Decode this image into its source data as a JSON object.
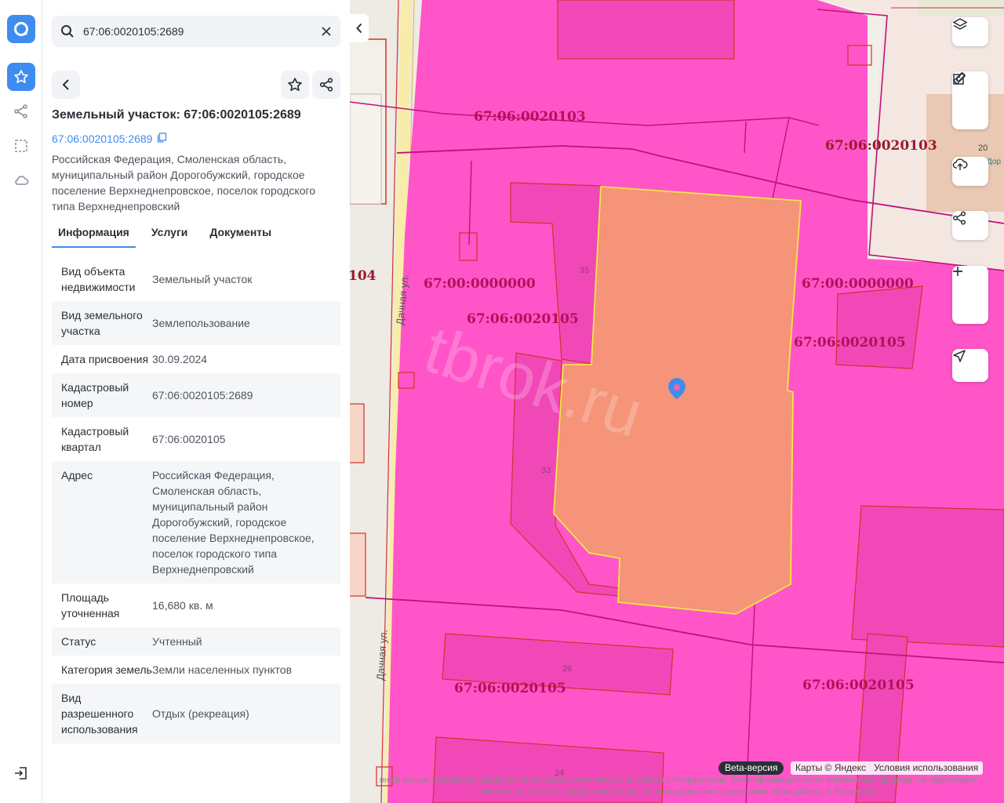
{
  "search": {
    "value": "67:06:0020105:2689"
  },
  "panel": {
    "title": "Земельный участок: 67:06:0020105:2689",
    "cad_link": "67:06:0020105:2689",
    "address": "Российская Федерация, Смоленская область, муниципальный район Дорогобужский, городское поселение Верхнеднепровское, поселок городского типа Верхнеднепровский"
  },
  "tabs": [
    {
      "label": "Информация",
      "active": true
    },
    {
      "label": "Услуги",
      "active": false
    },
    {
      "label": "Документы",
      "active": false
    }
  ],
  "info_rows": [
    {
      "key": "Вид объекта недвижимости",
      "value": "Земельный участок"
    },
    {
      "key": "Вид земельного участка",
      "value": "Землепользование"
    },
    {
      "key": "Дата присвоения",
      "value": "30.09.2024"
    },
    {
      "key": "Кадастровый номер",
      "value": "67:06:0020105:2689"
    },
    {
      "key": "Кадастровый квартал",
      "value": "67:06:0020105"
    },
    {
      "key": "Адрес",
      "value": "Российская Федерация, Смоленская область, муниципальный район Дорогобужский, городское поселение Верхнеднепровское, поселок городского типа Верхнеднепровский"
    },
    {
      "key": "Площадь уточненная",
      "value": "16,680 кв. м"
    },
    {
      "key": "Статус",
      "value": "Учтенный"
    },
    {
      "key": "Категория земель",
      "value": "Земли населенных пунктов"
    },
    {
      "key": "Вид разрешенного использования",
      "value": "Отдых (рекреация)"
    }
  ],
  "map": {
    "labels": [
      "67:06:0020103",
      "67:06:0020103",
      "67:00:0000000",
      "67:00:0000000",
      "67:06:0020105",
      "67:06:0020105",
      "67:06:0020105",
      "67:06:0020105",
      "104"
    ],
    "street": "Дачная ул.",
    "house_numbers": [
      "35",
      "33",
      "26",
      "24",
      "20"
    ],
    "partial_label": "Дор",
    "watermark": "tbrok.ru",
    "beta": "Beta-версия",
    "attribution": [
      "Карты © Яндекс",
      "Условия использования"
    ],
    "disclaimer": "нный ресурс использует сведения из открытых источников и не связан с Росреестром. Вся информация носит справочный характер, не гарантирует точность и не имеет юридической силы. За официальными сведениями обращайтесь в Росреестр."
  },
  "colors": {
    "accent": "#3f8cf0",
    "parcel_fill": "#ff55c8",
    "selected_fill": "#f59479",
    "selected_stroke": "#f5e642",
    "cad_label": "#b0125a"
  }
}
